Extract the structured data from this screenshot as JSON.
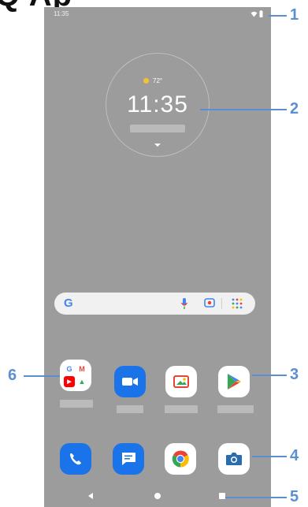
{
  "header": {
    "title_fragment": "Q Ap"
  },
  "status_bar": {
    "time": "11:35",
    "icons": [
      "wifi-icon",
      "battery-icon"
    ]
  },
  "clock_widget": {
    "weather_icon": "sun-icon",
    "temperature": "72°",
    "time": "11:35"
  },
  "search_bar": {
    "icons": [
      "google-g-icon",
      "mic-icon",
      "lens-icon",
      "app-grid-icon"
    ],
    "g_letter": "G"
  },
  "home_row": {
    "apps": [
      {
        "name": "Google folder",
        "icon": "folder-icon"
      },
      {
        "name": "Duo",
        "icon": "video-camera-icon"
      },
      {
        "name": "Photos",
        "icon": "photos-icon"
      },
      {
        "name": "Play Store",
        "icon": "play-store-icon"
      }
    ]
  },
  "folder_items": [
    {
      "letter": "G",
      "color": "#4285f4"
    },
    {
      "letter": "M",
      "color": "#ea4335"
    },
    {
      "letter": "▶",
      "color": "#ff0000"
    },
    {
      "letter": "▲",
      "color": "#34a853"
    }
  ],
  "dock": {
    "apps": [
      {
        "name": "Phone",
        "icon": "phone-icon"
      },
      {
        "name": "Messages",
        "icon": "messages-icon"
      },
      {
        "name": "Chrome",
        "icon": "chrome-icon"
      },
      {
        "name": "Camera",
        "icon": "camera-icon"
      }
    ]
  },
  "navigation": {
    "buttons": [
      "back",
      "home",
      "recents"
    ]
  },
  "callouts": [
    "1",
    "2",
    "3",
    "4",
    "5",
    "6"
  ],
  "colors": {
    "accent": "#5b8fd1",
    "wallpaper": "#9c9c9c",
    "app_blue": "#1a73e8"
  }
}
